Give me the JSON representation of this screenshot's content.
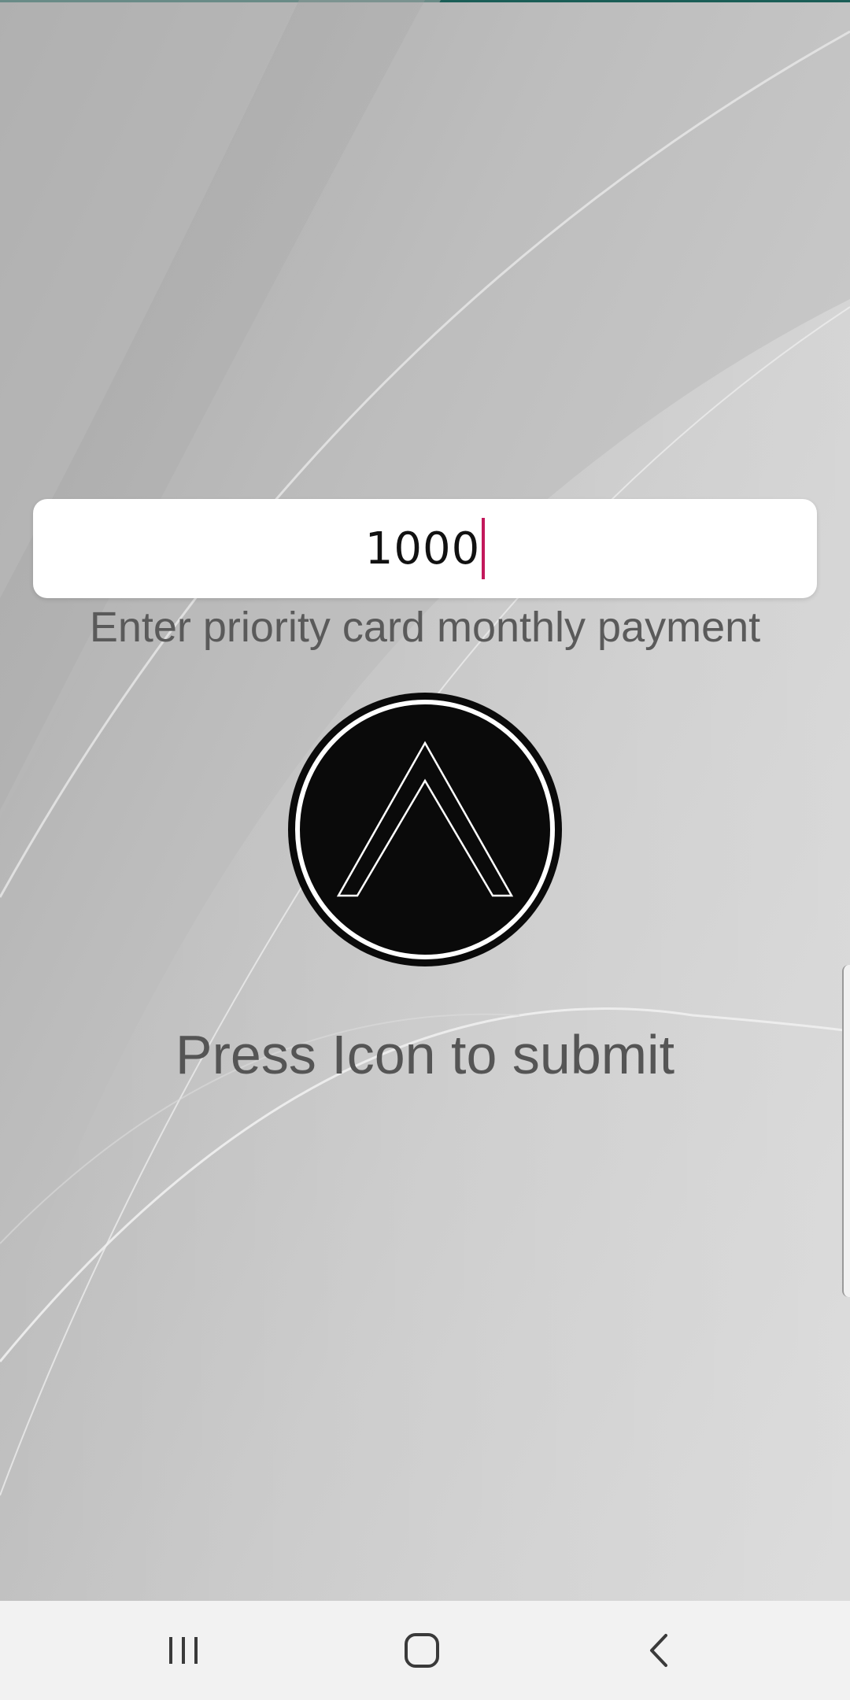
{
  "input": {
    "value": "1000"
  },
  "hint": {
    "text": "Enter priority card monthly payment"
  },
  "submit": {
    "icon": "up-chevron-circle-icon",
    "label": "Press Icon to submit"
  },
  "nav": {
    "recents_icon": "recents-icon",
    "home_icon": "home-icon",
    "back_icon": "back-icon"
  },
  "colors": {
    "top_accent": "#1b5e57",
    "caret": "#c2185b",
    "hint_text": "#5a5a5a",
    "icon_fill": "#0a0a0a",
    "nav_bar": "#f2f2f2"
  }
}
